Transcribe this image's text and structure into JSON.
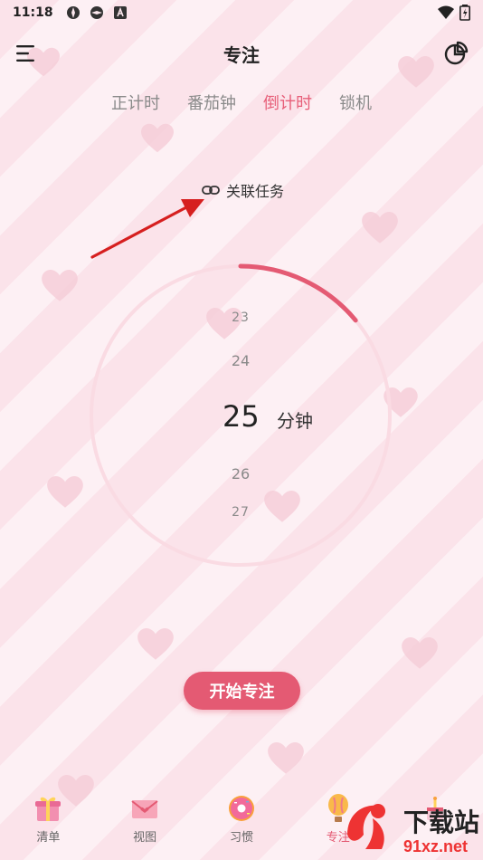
{
  "status_bar": {
    "time": "11:18",
    "icons": [
      "app-icon",
      "app-icon",
      "a-icon",
      "wifi-icon",
      "battery-icon"
    ]
  },
  "header": {
    "title": "专注",
    "menu_icon": "menu-icon",
    "stats_icon": "pie-chart-icon"
  },
  "tabs": [
    {
      "label": "正计时",
      "active": false
    },
    {
      "label": "番茄钟",
      "active": false
    },
    {
      "label": "倒计时",
      "active": true
    },
    {
      "label": "锁机",
      "active": false
    }
  ],
  "link_task": {
    "label": "关联任务",
    "icon": "link-icon"
  },
  "picker": {
    "values": [
      "23",
      "24",
      "25",
      "26",
      "27"
    ],
    "selected": "25",
    "unit": "分钟",
    "progress": 0.14
  },
  "start_button": {
    "label": "开始专注"
  },
  "bottom_nav": [
    {
      "label": "清单",
      "icon": "gift-icon",
      "active": false
    },
    {
      "label": "视图",
      "icon": "envelope-icon",
      "active": false
    },
    {
      "label": "习惯",
      "icon": "donut-icon",
      "active": false
    },
    {
      "label": "专注",
      "icon": "balloon-icon",
      "active": true
    },
    {
      "label": "",
      "icon": "cake-icon",
      "active": false
    }
  ],
  "watermark": {
    "text": "下载站",
    "url": "91xz.net"
  },
  "colors": {
    "accent": "#e45a73",
    "tab_active": "#e75f79",
    "background": "#fde9ef",
    "heart": "#f6cdd8"
  }
}
